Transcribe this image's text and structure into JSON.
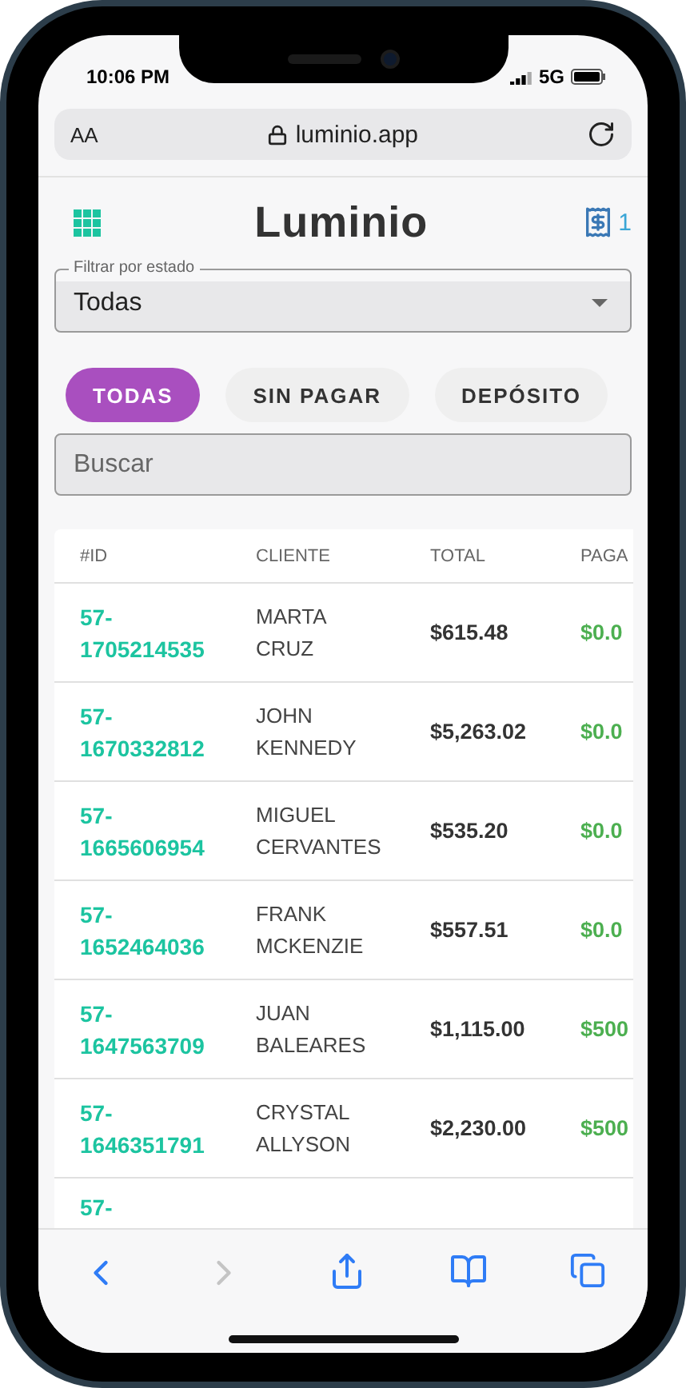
{
  "status_bar": {
    "time": "10:06 PM",
    "network": "5G"
  },
  "browser": {
    "text_size": "AA",
    "url": "luminio.app"
  },
  "header": {
    "logo": "Luminio",
    "cart_count": "1"
  },
  "filter": {
    "label": "Filtrar por estado",
    "value": "Todas"
  },
  "chips": [
    {
      "label": "TODAS",
      "selected": true
    },
    {
      "label": "SIN PAGAR",
      "selected": false
    },
    {
      "label": "DEPÓSITO",
      "selected": false
    }
  ],
  "search": {
    "placeholder": "Buscar"
  },
  "table": {
    "columns": [
      "#ID",
      "CLIENTE",
      "TOTAL",
      "PAGA"
    ],
    "rows": [
      {
        "id": "57-1705214535",
        "client": "MARTA CRUZ",
        "total": "$615.48",
        "paid": "$0.0"
      },
      {
        "id": "57-1670332812",
        "client": "JOHN KENNEDY",
        "total": "$5,263.02",
        "paid": "$0.0"
      },
      {
        "id": "57-1665606954",
        "client": "MIGUEL CERVANTES",
        "total": "$535.20",
        "paid": "$0.0"
      },
      {
        "id": "57-1652464036",
        "client": "FRANK MCKENZIE",
        "total": "$557.51",
        "paid": "$0.0"
      },
      {
        "id": "57-1647563709",
        "client": "JUAN BALEARES",
        "total": "$1,115.00",
        "paid": "$500"
      },
      {
        "id": "57-1646351791",
        "client": "CRYSTAL ALLYSON",
        "total": "$2,230.00",
        "paid": "$500"
      },
      {
        "id": "57-"
      }
    ]
  }
}
